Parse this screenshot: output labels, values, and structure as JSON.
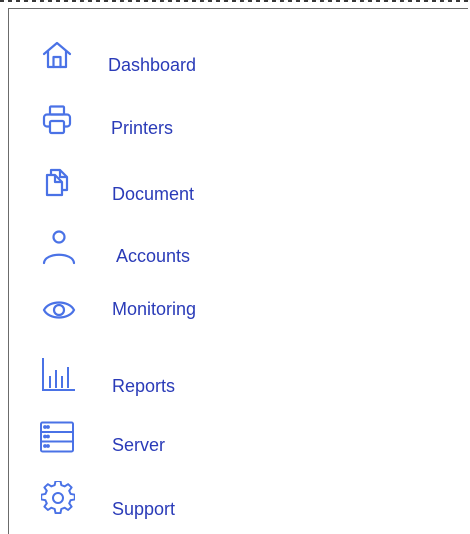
{
  "sidebar": {
    "accent_color": "#2a3bb8",
    "icon_color": "#4a72e6",
    "items": [
      {
        "label": "Dashboard",
        "icon": "home-icon"
      },
      {
        "label": "Printers",
        "icon": "printer-icon"
      },
      {
        "label": "Document",
        "icon": "document-icon"
      },
      {
        "label": "Accounts",
        "icon": "user-icon"
      },
      {
        "label": "Monitoring",
        "icon": "eye-icon"
      },
      {
        "label": "Reports",
        "icon": "bar-chart-icon"
      },
      {
        "label": "Server",
        "icon": "server-icon"
      },
      {
        "label": "Support",
        "icon": "gear-icon"
      }
    ]
  }
}
